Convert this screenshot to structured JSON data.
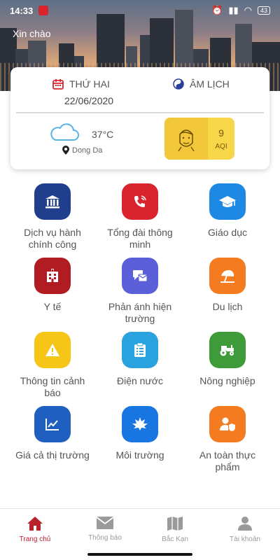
{
  "status_bar": {
    "time": "14:33",
    "battery": "43"
  },
  "greeting": "Xin chào",
  "date_card": {
    "weekday": "THỨ HAI",
    "date": "22/06/2020",
    "lunar_label": "ÂM LỊCH",
    "temperature": "37°C",
    "location": "Dong Da",
    "aqi_value": "9",
    "aqi_label": "AQI"
  },
  "services": [
    {
      "label": "Dịch vụ hành chính công",
      "icon": "government-building-icon",
      "color": "#1f3e8c"
    },
    {
      "label": "Tổng đài thông minh",
      "icon": "phone-ringing-icon",
      "color": "#d9232d"
    },
    {
      "label": "Giáo dục",
      "icon": "graduation-cap-icon",
      "color": "#1e88e5"
    },
    {
      "label": "Y tế",
      "icon": "hospital-icon",
      "color": "#b01c22"
    },
    {
      "label": "Phản ánh hiện trường",
      "icon": "feedback-icon",
      "color": "#5b5fd8"
    },
    {
      "label": "Du lịch",
      "icon": "beach-umbrella-icon",
      "color": "#f47b1f"
    },
    {
      "label": "Thông tin cảnh báo",
      "icon": "warning-icon",
      "color": "#f5c518"
    },
    {
      "label": "Điện nước",
      "icon": "clipboard-icon",
      "color": "#29a3e0"
    },
    {
      "label": "Nông nghiệp",
      "icon": "tractor-icon",
      "color": "#3f9b3a"
    },
    {
      "label": "Giá cả thị trường",
      "icon": "line-chart-icon",
      "color": "#1f5fc0"
    },
    {
      "label": "Môi trường",
      "icon": "leaf-icon",
      "color": "#1976e0"
    },
    {
      "label": "An toàn thực phẩm",
      "icon": "user-shield-icon",
      "color": "#f47b1f"
    }
  ],
  "bottom_nav": [
    {
      "label": "Trang chủ",
      "icon": "home-icon",
      "active": true
    },
    {
      "label": "Thông báo",
      "icon": "mail-icon",
      "active": false
    },
    {
      "label": "Bắc Kạn",
      "icon": "map-icon",
      "active": false
    },
    {
      "label": "Tài khoản",
      "icon": "user-icon",
      "active": false
    }
  ]
}
